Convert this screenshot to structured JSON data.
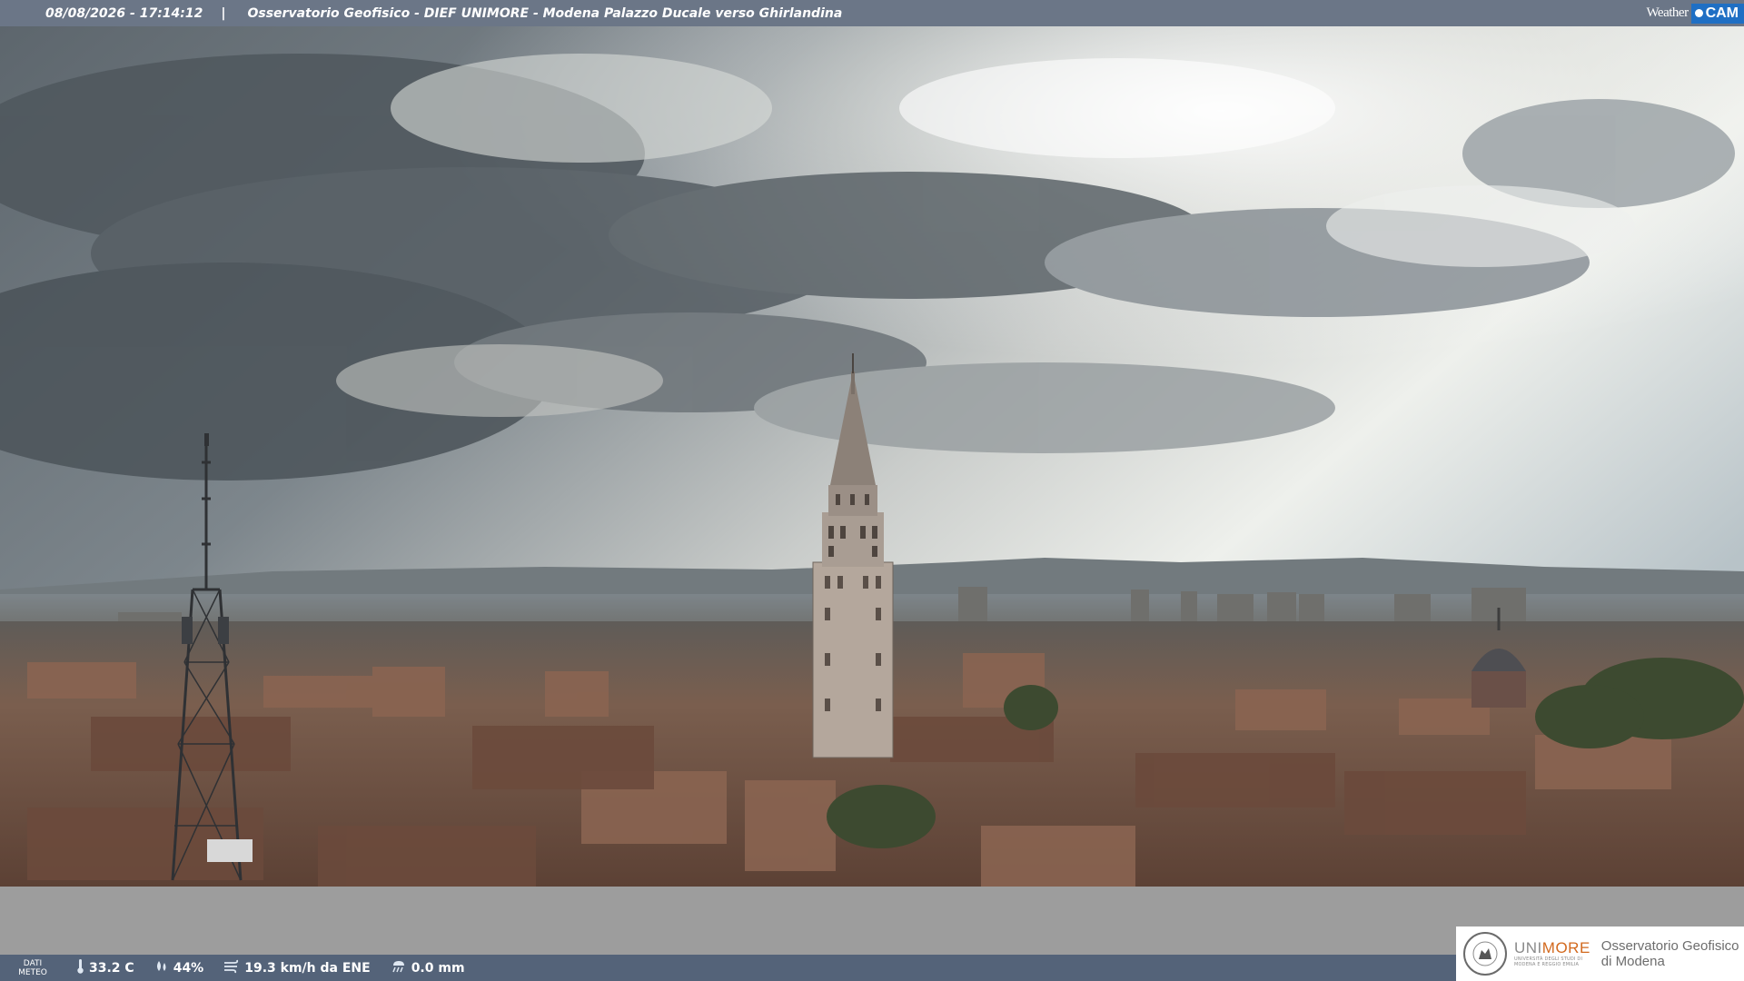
{
  "overlay": {
    "timestamp": "08/08/2026 - 17:14:12",
    "separator": "|",
    "caption": "Osservatorio Geofisico - DIEF UNIMORE - Modena Palazzo Ducale verso Ghirlandina"
  },
  "brand": {
    "weather": "Weather",
    "cam": "CAM"
  },
  "weather_bar": {
    "label_line1": "DATI",
    "label_line2": "METEO",
    "temperature": "33.2 C",
    "humidity": "44%",
    "wind": "19.3 km/h da ENE",
    "rain": "0.0 mm",
    "icons": {
      "temperature": "thermometer-icon",
      "humidity": "humidity-drop-icon",
      "wind": "wind-icon",
      "rain": "rain-icon"
    }
  },
  "logo": {
    "uni": "UNI",
    "more": "MORE",
    "sub_line1": "UNIVERSITÀ DEGLI STUDI DI",
    "sub_line2": "MODENA E REGGIO EMILIA",
    "title_line1": "Osservatorio Geofisico",
    "title_line2": "di Modena",
    "accent_color": "#d2691e"
  },
  "scene": {
    "subject": "Ghirlandina",
    "sky_color": "#8e969c",
    "roof_color": "#7a5a48"
  }
}
